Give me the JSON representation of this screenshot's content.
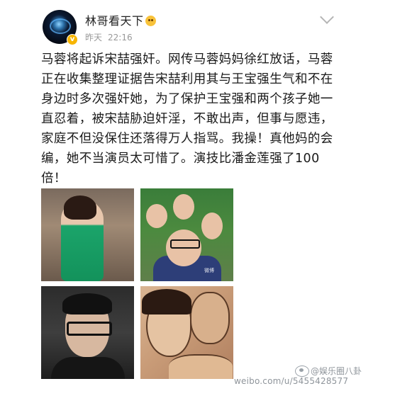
{
  "header": {
    "username": "林哥看天下",
    "emoji_icon": "crying-emoji-icon",
    "time_label": "昨天",
    "time_value": "22:16",
    "verified_badge": "v"
  },
  "post": {
    "text": "马蓉将起诉宋喆强奸。网传马蓉妈妈徐红放话，马蓉正在收集整理证据告宋喆利用其与王宝强生气和不在身边时多次强奸她，为了保护王宝强和两个孩子她一直忍着，被宋喆胁迫奸淫，不敢出声，但事与愿违，家庭不但没保住还落得万人指骂。我操！真他妈的会编，她不当演员太可惜了。演技比潘金莲强了100倍！"
  },
  "images": [
    {
      "name": "photo-woman-green-dress"
    },
    {
      "name": "photo-family-selfie",
      "watermark": "微博"
    },
    {
      "name": "photo-man-glasses"
    },
    {
      "name": "photo-couple-illustration"
    }
  ],
  "watermark": {
    "name": "@娱乐圈八卦",
    "url": "weibo.com/u/5455428577"
  },
  "colors": {
    "text": "#1a1a1a",
    "meta": "#999999",
    "badge": "#f7b500",
    "watermark": "#8f959b"
  }
}
